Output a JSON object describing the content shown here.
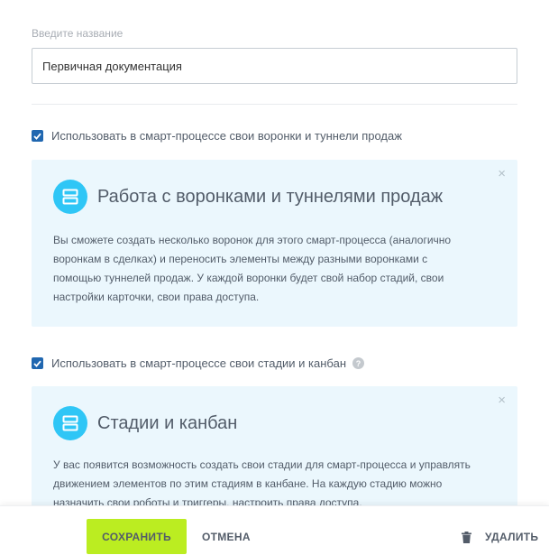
{
  "name_field": {
    "label": "Введите название",
    "value": "Первичная документация"
  },
  "option_funnels": {
    "checked": true,
    "label": "Использовать в смарт-процессе свои воронки и туннели продаж"
  },
  "card_funnels": {
    "icon": "stages-icon",
    "close": "×",
    "title": "Работа с воронками и туннелями продаж",
    "text": "Вы сможете создать несколько воронок для этого смарт-процесса (аналогично воронкам в сделках) и переносить элементы между разными воронками с помощью туннелей продаж. У каждой воронки будет свой набор стадий, свои настройки карточки, свои права доступа."
  },
  "option_stages": {
    "checked": true,
    "label": "Использовать в смарт-процессе свои стадии и канбан",
    "help": "?"
  },
  "card_stages": {
    "icon": "stages-icon",
    "close": "×",
    "title": "Стадии и канбан",
    "text": "У вас появится возможность создать свои стадии для смарт-процесса и управлять движением элементов по этим стадиям в канбане. На каждую стадию можно назначить свои роботы и триггеры, настроить права доступа."
  },
  "footer": {
    "save": "СОХРАНИТЬ",
    "cancel": "ОТМЕНА",
    "delete": "УДАЛИТЬ"
  },
  "colors": {
    "accent_green": "#bbed21",
    "checkbox_blue": "#2067b0",
    "card_bg": "#ebf7fd",
    "icon_blue": "#2fc6f6"
  }
}
